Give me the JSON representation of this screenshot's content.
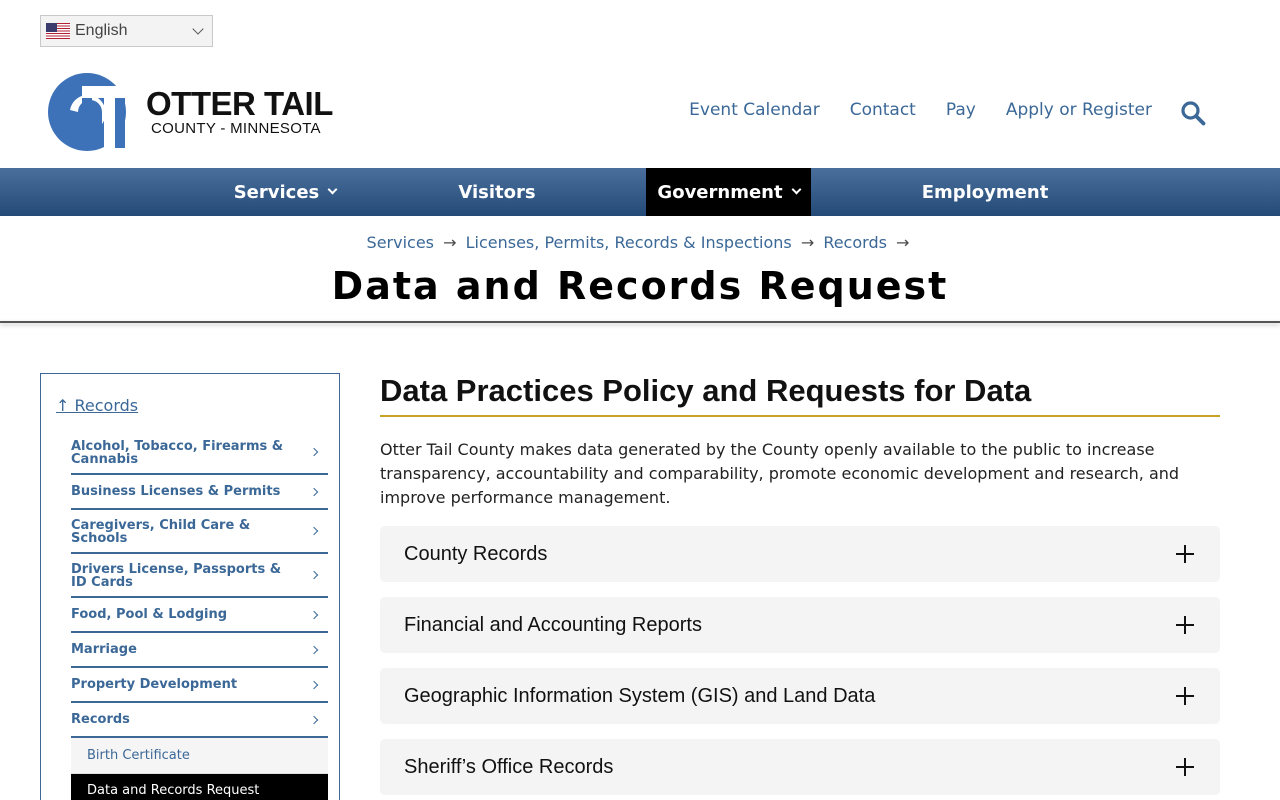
{
  "language": {
    "selected": "English",
    "flag_icon": "us-flag-icon"
  },
  "logo": {
    "name": "OTTER TAIL",
    "subtitle": "COUNTY - MINNESOTA",
    "brand_color": "#3d72b8"
  },
  "utility_nav": [
    "Event Calendar",
    "Contact",
    "Pay",
    "Apply or Register"
  ],
  "main_nav": [
    {
      "label": "Services",
      "dropdown": true,
      "active": false
    },
    {
      "label": "Visitors",
      "dropdown": false,
      "active": false
    },
    {
      "label": "Government",
      "dropdown": true,
      "active": true
    },
    {
      "label": "Employment",
      "dropdown": false,
      "active": false
    }
  ],
  "breadcrumb": [
    "Services",
    "Licenses, Permits, Records & Inspections",
    "Records"
  ],
  "breadcrumb_separator": "→",
  "page_title": "Data and Records Request",
  "sidebar": {
    "up_link": "↑ Records",
    "items": [
      "Alcohol, Tobacco, Firearms & Cannabis",
      "Business Licenses & Permits",
      "Caregivers, Child Care & Schools",
      "Drivers License, Passports & ID Cards",
      "Food, Pool & Lodging",
      "Marriage",
      "Property Development",
      "Records"
    ],
    "sub_items": [
      "Birth Certificate",
      "Data and Records Request"
    ],
    "current_sub_item": "Data and Records Request"
  },
  "content": {
    "section_title": "Data Practices Policy and Requests for Data",
    "intro": "Otter Tail County makes data generated by the County openly available to the public to increase transparency, accountability and comparability, promote economic development and research, and improve performance management.",
    "accordion": [
      "County Records",
      "Financial and Accounting Reports",
      "Geographic Information System (GIS) and Land Data",
      "Sheriff’s Office Records"
    ]
  },
  "colors": {
    "link": "#3b6897",
    "nav_bg": "#2f5787",
    "nav_active": "#000000",
    "accent_rule": "#c9a227"
  }
}
